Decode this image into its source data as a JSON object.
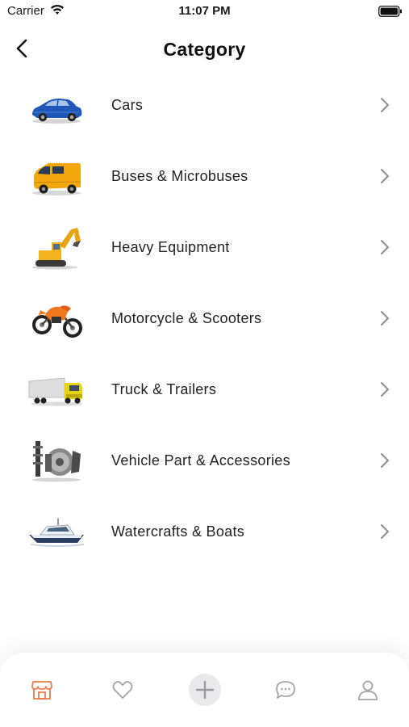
{
  "status_bar": {
    "carrier": "Carrier",
    "time": "11:07 PM"
  },
  "header": {
    "title": "Category"
  },
  "categories": [
    {
      "label": "Cars",
      "icon": "car-icon"
    },
    {
      "label": "Buses & Microbuses",
      "icon": "van-icon"
    },
    {
      "label": "Heavy Equipment",
      "icon": "excavator-icon"
    },
    {
      "label": "Motorcycle & Scooters",
      "icon": "motorcycle-icon"
    },
    {
      "label": "Truck & Trailers",
      "icon": "truck-icon"
    },
    {
      "label": "Vehicle Part & Accessories",
      "icon": "parts-icon"
    },
    {
      "label": "Watercrafts & Boats",
      "icon": "boat-icon"
    }
  ],
  "tab_bar": {
    "active_tab": "shop",
    "accent_color": "#f07a4a",
    "tabs": [
      "shop-icon",
      "heart-icon",
      "plus-icon",
      "chat-icon",
      "profile-icon"
    ]
  }
}
